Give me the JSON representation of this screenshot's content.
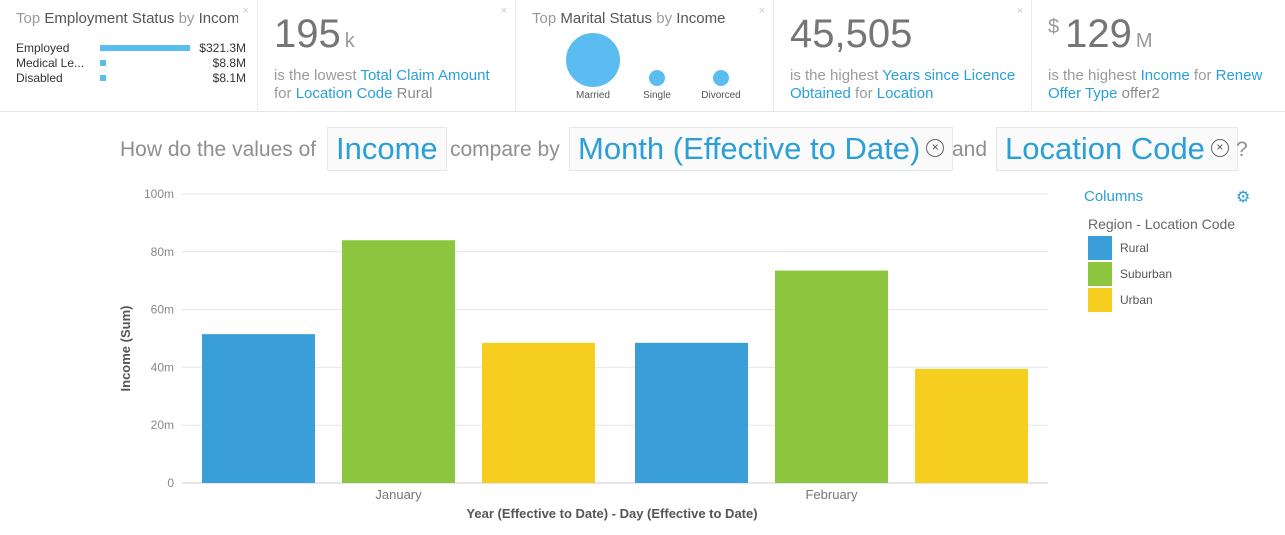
{
  "cards": {
    "employment": {
      "title_pre": "Top ",
      "title_hl": "Employment Status",
      "title_mid": " by ",
      "title_hl2": "Income",
      "rows": [
        {
          "label": "Employed",
          "value": "$321.3M",
          "amount": 321.3
        },
        {
          "label": "Medical Le...",
          "value": "$8.8M",
          "amount": 8.8
        },
        {
          "label": "Disabled",
          "value": "$8.1M",
          "amount": 8.1
        }
      ],
      "close": "×"
    },
    "claim": {
      "value": "195",
      "unit": "k",
      "s1": "is the lowest ",
      "field": "Total Claim Amount",
      "s2": "for ",
      "group": "Location Code",
      "group_value": " Rural",
      "close": "×"
    },
    "marital": {
      "title_pre": "Top ",
      "title_hl": "Marital Status",
      "title_mid": " by ",
      "title_hl2": "Income",
      "bubbles": [
        {
          "label": "Married",
          "amount": 1.0
        },
        {
          "label": "Single",
          "amount": 0.09
        },
        {
          "label": "Divorced",
          "amount": 0.09
        }
      ],
      "close": "×"
    },
    "licence": {
      "value": "45,505",
      "s1": "is the highest ",
      "field": "Years since Licence Obtained",
      "s2": " for ",
      "group": "Location",
      "close": "×"
    },
    "renew": {
      "currency": "$",
      "value": "129",
      "unit": "M",
      "s1": "is the highest ",
      "field": "Income",
      "s2": " for ",
      "group": "Renew Offer Type",
      "group_value": " offer2"
    }
  },
  "question": {
    "prefix": "How do the values of",
    "measure": "Income",
    "mid": "compare by",
    "dim1": "Month (Effective to Date)",
    "and": "and",
    "dim2": "Location Code",
    "suffix": "?",
    "remove_glyph": "×"
  },
  "legend": {
    "header": "Columns",
    "gear_glyph": "⚙",
    "subtitle": "Region - Location Code",
    "items": [
      {
        "label": "Rural",
        "color": "#3a9fd8"
      },
      {
        "label": "Suburban",
        "color": "#8cc63f"
      },
      {
        "label": "Urban",
        "color": "#f6ce1f"
      }
    ]
  },
  "chart_data": {
    "type": "bar",
    "categories": [
      "January",
      "February"
    ],
    "series": [
      {
        "name": "Rural",
        "values": [
          51.5,
          48.5
        ],
        "color": "#3a9fd8"
      },
      {
        "name": "Suburban",
        "values": [
          84,
          73.5
        ],
        "color": "#8cc63f"
      },
      {
        "name": "Urban",
        "values": [
          48.5,
          39.5
        ],
        "color": "#f6ce1f"
      }
    ],
    "ylim": [
      0,
      100
    ],
    "yticks": [
      0,
      20,
      40,
      60,
      80,
      100
    ],
    "ytick_labels": [
      "0",
      "20m",
      "40m",
      "60m",
      "80m",
      "100m"
    ],
    "xlabel": "Year (Effective to Date) - Day (Effective to Date)",
    "ylabel": "Income (Sum)",
    "grid": true,
    "legend_position": "right"
  }
}
